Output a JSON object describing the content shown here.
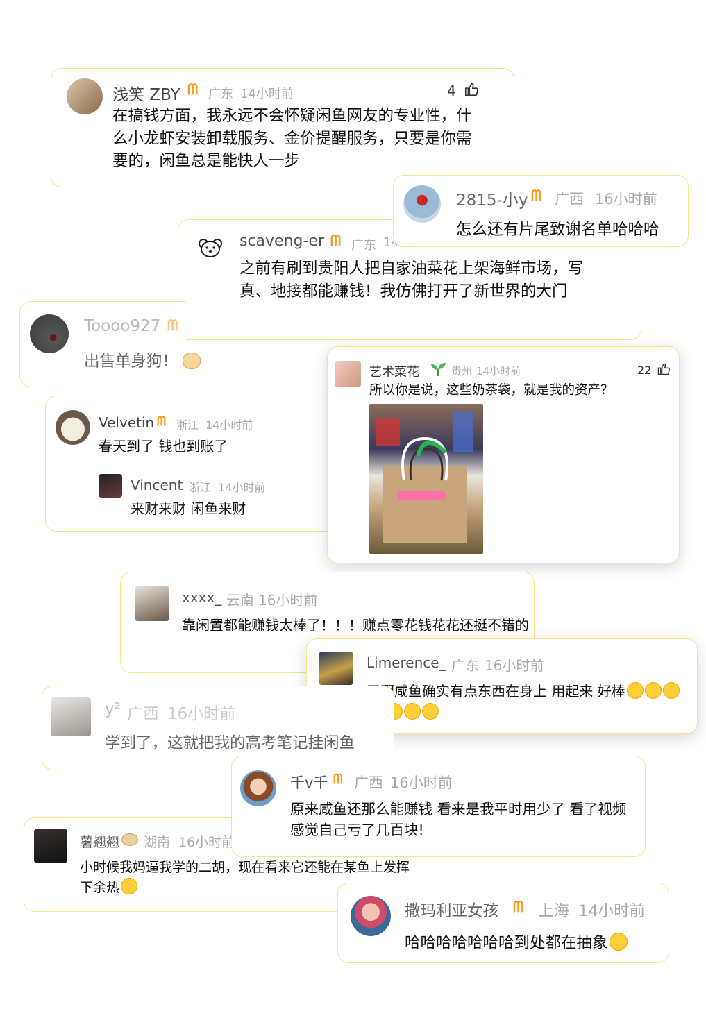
{
  "comments": [
    {
      "name": "浅笑 ZBY",
      "region": "广东",
      "time": "14小时前",
      "likes": "4",
      "text": "在搞钱方面，我永远不会怀疑闲鱼网友的专业性，什么小龙虾安装卸载服务、金价提醒服务，只要是你需要的，闲鱼总是能快人一步"
    },
    {
      "name": "2815-小y",
      "region": "广西",
      "time": "16小时前",
      "text": "怎么还有片尾致谢名单哈哈哈"
    },
    {
      "name": "scaveng-er",
      "region": "广东",
      "time": "14",
      "text": "之前有刷到贵阳人把自家油菜花上架海鲜市场，写真、地接都能赚钱！我仿佛打开了新世界的大门"
    },
    {
      "name": "Toooo927",
      "text": "出售单身狗！"
    },
    {
      "name": "艺术菜花",
      "region": "贵州",
      "time": "14小时前",
      "likes": "22",
      "text": "所以你是说，这些奶茶袋，就是我的资产？"
    },
    {
      "name": "Velvetin",
      "region": "浙江",
      "time": "14小时前",
      "text": "春天到了 钱也到账了",
      "reply": {
        "name": "Vincent",
        "region": "浙江",
        "time": "14小时前",
        "text": "来财来财 闲鱼来财"
      }
    },
    {
      "name": "xxxx_",
      "region": "云南",
      "time": "16小时前",
      "text": "靠闲置都能赚钱太棒了！！！赚点零花钱花花还挺不错的"
    },
    {
      "name": "Limerence_",
      "region": "广东",
      "time": "16小时前",
      "text": "天啊咸鱼确实有点东西在身上 用起来 好棒"
    },
    {
      "name": "y²",
      "region": "广西",
      "time": "16小时前",
      "text": "学到了，这就把我的高考笔记挂闲鱼"
    },
    {
      "name": "千v千",
      "region": "广西",
      "time": "16小时前",
      "text": "原来咸鱼还那么能赚钱 看来是我平时用少了 看了视频感觉自己亏了几百块!"
    },
    {
      "name": "薯翘翘",
      "region": "湖南",
      "time": "16小时前",
      "text": "小时候我妈逼我学的二胡，现在看来它还能在某鱼上发挥下余热"
    },
    {
      "name": "撒玛利亚女孩",
      "region": "上海",
      "time": "14小时前",
      "text": "哈哈哈哈哈哈哈到处都在抽象"
    }
  ],
  "icons": {
    "vip": "vip-badge-icon",
    "like": "thumbs-up-icon",
    "sprout": "sprout-icon"
  },
  "colors": {
    "border": "#f6e48a",
    "vip": "#ff9a1f",
    "meta": "#aaaaaa"
  }
}
